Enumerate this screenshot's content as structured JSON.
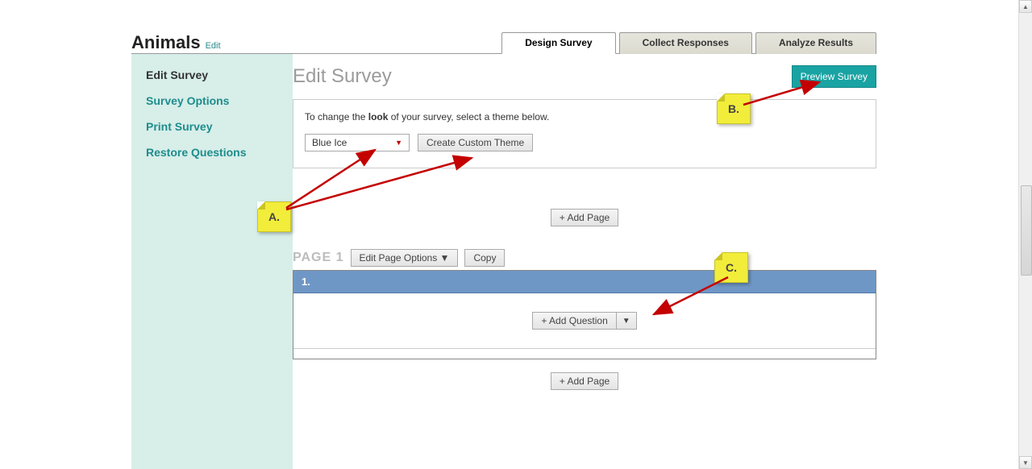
{
  "header": {
    "survey_title": "Animals",
    "edit_link": "Edit"
  },
  "tabs": {
    "design": "Design Survey",
    "collect": "Collect Responses",
    "analyze": "Analyze Results"
  },
  "sidebar": {
    "items": [
      {
        "label": "Edit Survey",
        "current": true
      },
      {
        "label": "Survey Options"
      },
      {
        "label": "Print Survey"
      },
      {
        "label": "Restore Questions"
      }
    ]
  },
  "main": {
    "heading": "Edit Survey",
    "preview_btn": "Preview Survey",
    "theme_instruction_pre": "To change the ",
    "theme_instruction_bold": "look",
    "theme_instruction_post": " of your survey, select a theme below.",
    "theme_selected": "Blue Ice",
    "create_theme_btn": "Create Custom Theme",
    "add_page_btn": "+ Add Page",
    "page_label": "PAGE 1",
    "edit_page_options_btn": "Edit Page Options ▼",
    "copy_btn": "Copy",
    "question_number": "1.",
    "add_question_btn": "+ Add Question",
    "add_question_caret": "▼"
  },
  "annotations": {
    "a": "A.",
    "b": "B.",
    "c": "C."
  }
}
